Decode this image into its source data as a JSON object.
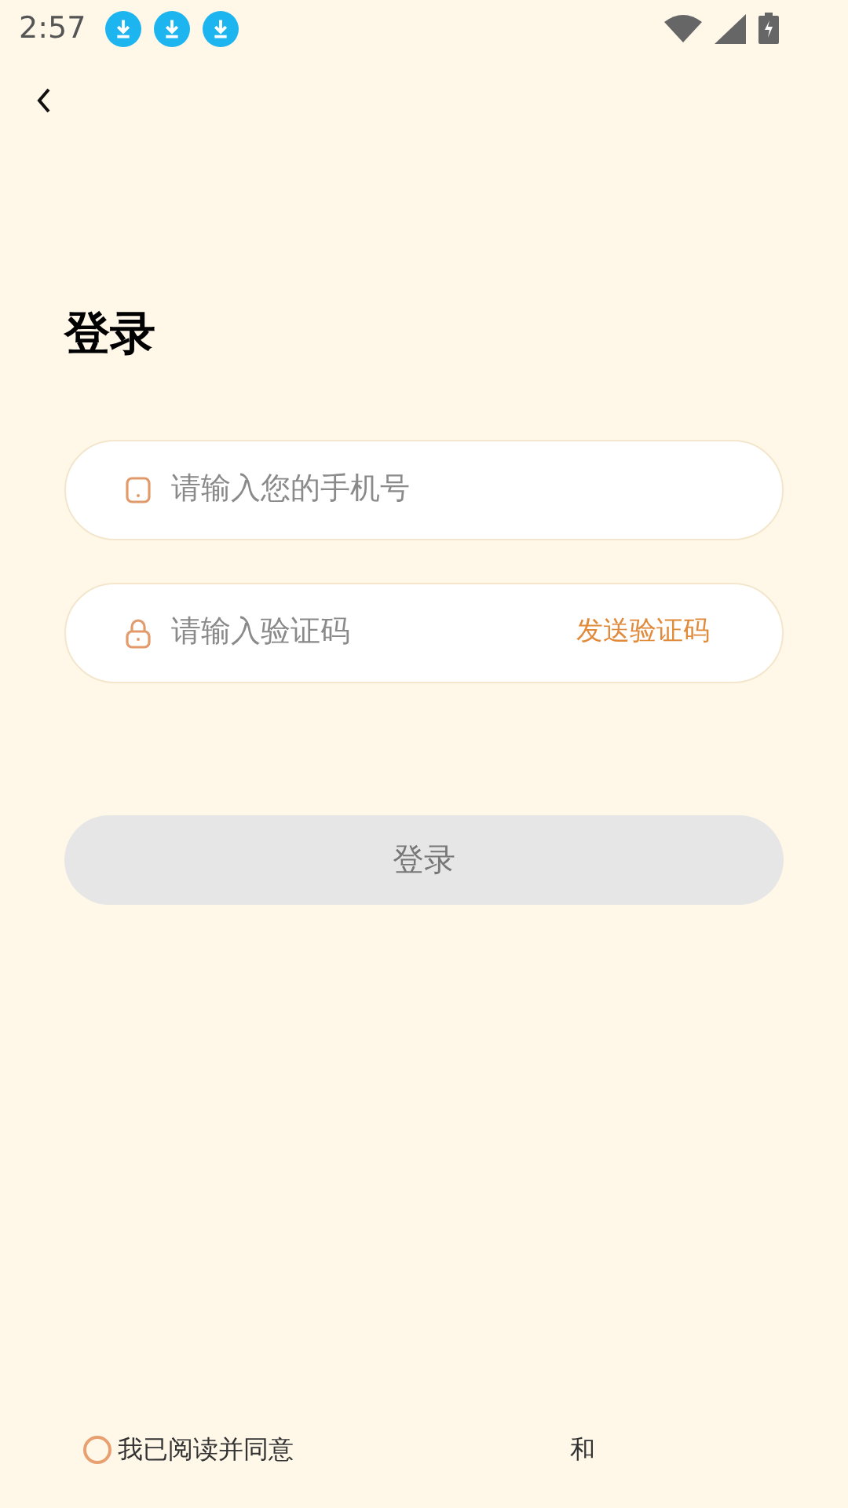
{
  "status_bar": {
    "time": "2:57",
    "notifications": [
      {
        "kind": "download"
      },
      {
        "kind": "download"
      },
      {
        "kind": "download"
      }
    ]
  },
  "title": "登录",
  "phone_field": {
    "placeholder": "请输入您的手机号"
  },
  "code_field": {
    "placeholder": "请输入验证码",
    "send_code": "发送验证码"
  },
  "login_button": {
    "label": "登录",
    "disabled": true
  },
  "agreement": {
    "checked": false,
    "text": "我已阅读并同意",
    "conjunction": "和"
  }
}
